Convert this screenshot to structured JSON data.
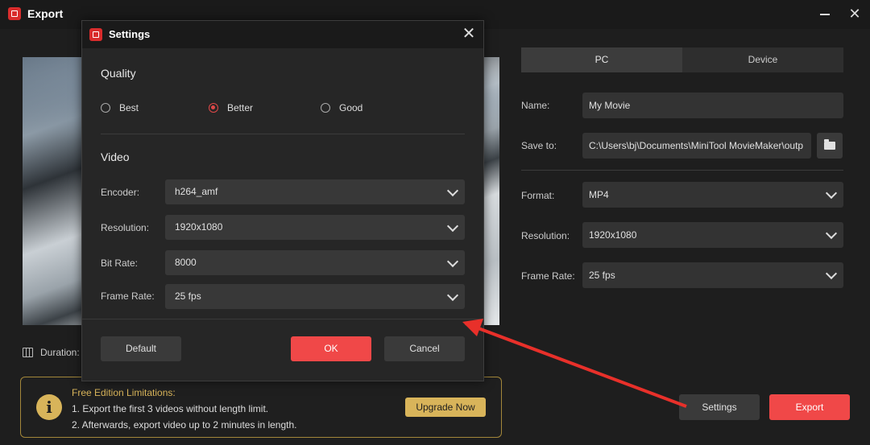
{
  "window": {
    "title": "Export"
  },
  "preview": {
    "duration_label": "Duration:"
  },
  "tabs": [
    {
      "label": "PC",
      "active": true
    },
    {
      "label": "Device",
      "active": false
    }
  ],
  "form": {
    "name_label": "Name:",
    "name_value": "My Movie",
    "save_label": "Save to:",
    "save_value": "C:\\Users\\bj\\Documents\\MiniTool MovieMaker\\outp",
    "format_label": "Format:",
    "format_value": "MP4",
    "resolution_label": "Resolution:",
    "resolution_value": "1920x1080",
    "framerate_label": "Frame Rate:",
    "framerate_value": "25 fps"
  },
  "limits": {
    "title": "Free Edition Limitations:",
    "line1": "1. Export the first 3 videos without length limit.",
    "line2": "2. Afterwards, export video up to 2 minutes in length.",
    "upgrade_label": "Upgrade Now"
  },
  "actions": {
    "settings_label": "Settings",
    "export_label": "Export"
  },
  "dialog": {
    "title": "Settings",
    "quality_title": "Quality",
    "quality_options": [
      {
        "label": "Best",
        "selected": false
      },
      {
        "label": "Better",
        "selected": true
      },
      {
        "label": "Good",
        "selected": false
      }
    ],
    "video_title": "Video",
    "encoder_label": "Encoder:",
    "encoder_value": "h264_amf",
    "resolution_label": "Resolution:",
    "resolution_value": "1920x1080",
    "bitrate_label": "Bit Rate:",
    "bitrate_value": "8000",
    "framerate_label": "Frame Rate:",
    "framerate_value": "25 fps",
    "default_label": "Default",
    "ok_label": "OK",
    "cancel_label": "Cancel"
  },
  "colors": {
    "accent": "#f04848",
    "warning": "#d8b45a",
    "annotation_arrow": "#e8302a"
  }
}
